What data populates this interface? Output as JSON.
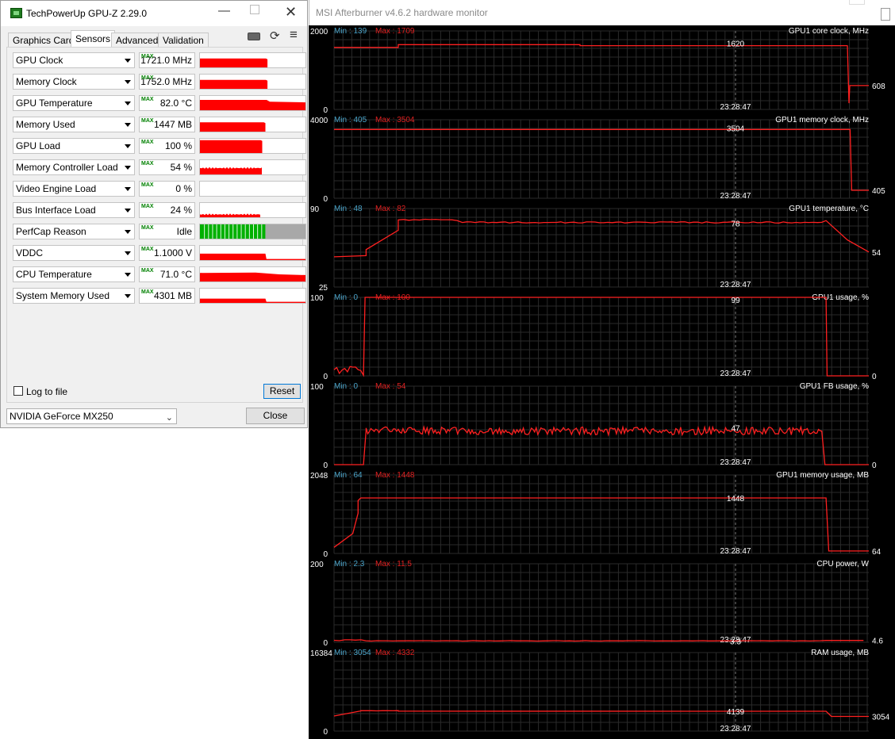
{
  "gpuz": {
    "title": "TechPowerUp GPU-Z 2.29.0",
    "window_controls": {
      "minimize": "—",
      "close": "✕"
    },
    "tabs": [
      "Graphics Card",
      "Sensors",
      "Advanced",
      "Validation"
    ],
    "active_tab": "Sensors",
    "max_badge": "MAX",
    "sensors": [
      {
        "label": "GPU Clock",
        "value": "1721.0 MHz",
        "graph": "flat",
        "level": 0.62,
        "spans": [
          0,
          0.64
        ]
      },
      {
        "label": "Memory Clock",
        "value": "1752.0 MHz",
        "graph": "flat",
        "level": 0.62,
        "spans": [
          0,
          0.64
        ]
      },
      {
        "label": "GPU Temperature",
        "value": "82.0 °C",
        "graph": "temp",
        "level": 0.68,
        "spans": [
          0,
          1
        ]
      },
      {
        "label": "Memory Used",
        "value": "1447 MB",
        "graph": "flat",
        "level": 0.65,
        "spans": [
          0,
          0.62
        ]
      },
      {
        "label": "GPU Load",
        "value": "100 %",
        "graph": "flat",
        "level": 0.9,
        "spans": [
          0,
          0.59
        ]
      },
      {
        "label": "Memory Controller Load",
        "value": "54 %",
        "graph": "noise",
        "level": 0.45,
        "spans": [
          0,
          0.59
        ]
      },
      {
        "label": "Video Engine Load",
        "value": "0 %",
        "graph": "none",
        "level": 0,
        "spans": [
          0,
          0
        ]
      },
      {
        "label": "Bus Interface Load",
        "value": "24 %",
        "graph": "noise",
        "level": 0.2,
        "spans": [
          0,
          0.58
        ]
      },
      {
        "label": "PerfCap Reason",
        "value": "Idle",
        "graph": "perfcap",
        "level": 1,
        "spans": [
          0,
          0.62
        ]
      },
      {
        "label": "VDDC",
        "value": "1.1000 V",
        "graph": "step",
        "level": 0.45,
        "spans": [
          0,
          1
        ]
      },
      {
        "label": "CPU Temperature",
        "value": "71.0 °C",
        "graph": "cputemp",
        "level": 0.55,
        "spans": [
          0,
          1
        ]
      },
      {
        "label": "System Memory Used",
        "value": "4301 MB",
        "graph": "step",
        "level": 0.3,
        "spans": [
          0,
          1
        ]
      }
    ],
    "log_to_file": "Log to file",
    "reset": "Reset",
    "gpu_select": "NVIDIA GeForce MX250",
    "close": "Close",
    "colors": {
      "graph": "#ff0000",
      "perfcap_on": "#00b000",
      "perfcap_off": "#a8a8a8"
    }
  },
  "afterburner": {
    "title": "MSI Afterburner v4.6.2 hardware monitor",
    "cursor_time": "23:28:47",
    "colors": {
      "line": "#ff2020",
      "min": "#4aa3c8",
      "max": "#e02020",
      "grid": "#2a2a2a"
    },
    "panels": [
      {
        "name": "GPU1 core clock, MHz",
        "min": "Min : 139",
        "max": "Max : 1709",
        "ymin": "0",
        "ymax": "2000",
        "lo": 0,
        "hi": 2000,
        "cursor_value": "1620",
        "end_value": "608",
        "segments": [
          [
            0,
            1580
          ],
          [
            0.115,
            1580
          ],
          [
            0.12,
            1650
          ],
          [
            0.45,
            1650
          ],
          [
            0.46,
            1625
          ],
          [
            0.7,
            1625
          ],
          [
            1.0,
            1630
          ]
        ],
        "tail": {
          "start": 0,
          "drop_at": 0.96,
          "to": 608,
          "dip": 160
        }
      },
      {
        "name": "GPU1 memory clock, MHz",
        "min": "Min : 405",
        "max": "Max : 3504",
        "ymin": "0",
        "ymax": "4000",
        "lo": 0,
        "hi": 4000,
        "cursor_value": "3504",
        "end_value": "405",
        "segments": [
          [
            0,
            3504
          ],
          [
            1.0,
            3504
          ]
        ],
        "tail": {
          "start": 0,
          "drop_at": 0.965,
          "to": 405
        }
      },
      {
        "name": "GPU1 temperature, °C",
        "min": "Min : 48",
        "max": "Max : 82",
        "ymin": "25",
        "ymax": "90",
        "lo": 25,
        "hi": 90,
        "cursor_value": "78",
        "end_value": "54",
        "temp": true
      },
      {
        "name": "GPU1 usage, %",
        "min": "Min : 0",
        "max": "Max : 100",
        "ymin": "0",
        "ymax": "100",
        "lo": 0,
        "hi": 100,
        "cursor_value": "99",
        "end_value": "0",
        "usage": true
      },
      {
        "name": "GPU1 FB usage, %",
        "min": "Min : 0",
        "max": "Max : 54",
        "ymin": "0",
        "ymax": "100",
        "lo": 0,
        "hi": 100,
        "cursor_value": "47",
        "end_value": "0",
        "fb": true
      },
      {
        "name": "GPU1 memory usage, MB",
        "min": "Min : 64",
        "max": "Max : 1448",
        "ymin": "0",
        "ymax": "2048",
        "lo": 0,
        "hi": 2048,
        "cursor_value": "1448",
        "end_value": "64",
        "memusage": true
      },
      {
        "name": "CPU power, W",
        "min": "Min : 2.3",
        "max": "Max : 11.5",
        "ymin": "0",
        "ymax": "200",
        "lo": 0,
        "hi": 200,
        "cursor_value": "3.3",
        "end_value": "4.6",
        "cpupower": true
      },
      {
        "name": "RAM usage, MB",
        "min": "Min : 3054",
        "max": "Max : 4332",
        "ymin": "0",
        "ymax": "16384",
        "lo": 0,
        "hi": 16384,
        "cursor_value": "4139",
        "end_value": "3054",
        "ram": true
      }
    ]
  }
}
